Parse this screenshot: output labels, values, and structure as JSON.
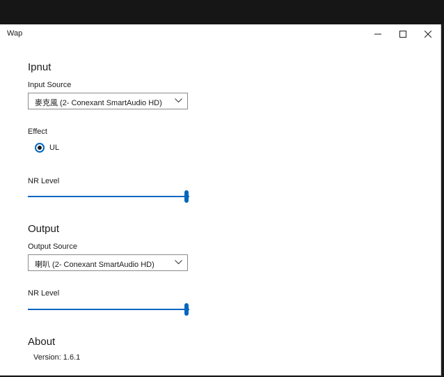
{
  "window": {
    "title": "Wap"
  },
  "input": {
    "section_title": "Ipnut",
    "source_label": "Input Source",
    "source_value": "麥克風 (2- Conexant SmartAudio HD)",
    "effect_label": "Effect",
    "effect_option": "UL",
    "effect_selected": true,
    "nr_label": "NR Level",
    "nr_level": 1.0
  },
  "output": {
    "section_title": "Output",
    "source_label": "Output Source",
    "source_value": "喇叭 (2- Conexant SmartAudio HD)",
    "nr_label": "NR Level",
    "nr_level": 1.0
  },
  "about": {
    "section_title": "About",
    "version": "Version: 1.6.1"
  },
  "colors": {
    "accent": "#0067c0",
    "track": "#c8c8c8",
    "text": "#1a1a1a"
  },
  "icons": {
    "minimize": "minimize-icon",
    "maximize": "maximize-icon",
    "close": "close-icon",
    "dropdown": "chevron-down-icon"
  }
}
